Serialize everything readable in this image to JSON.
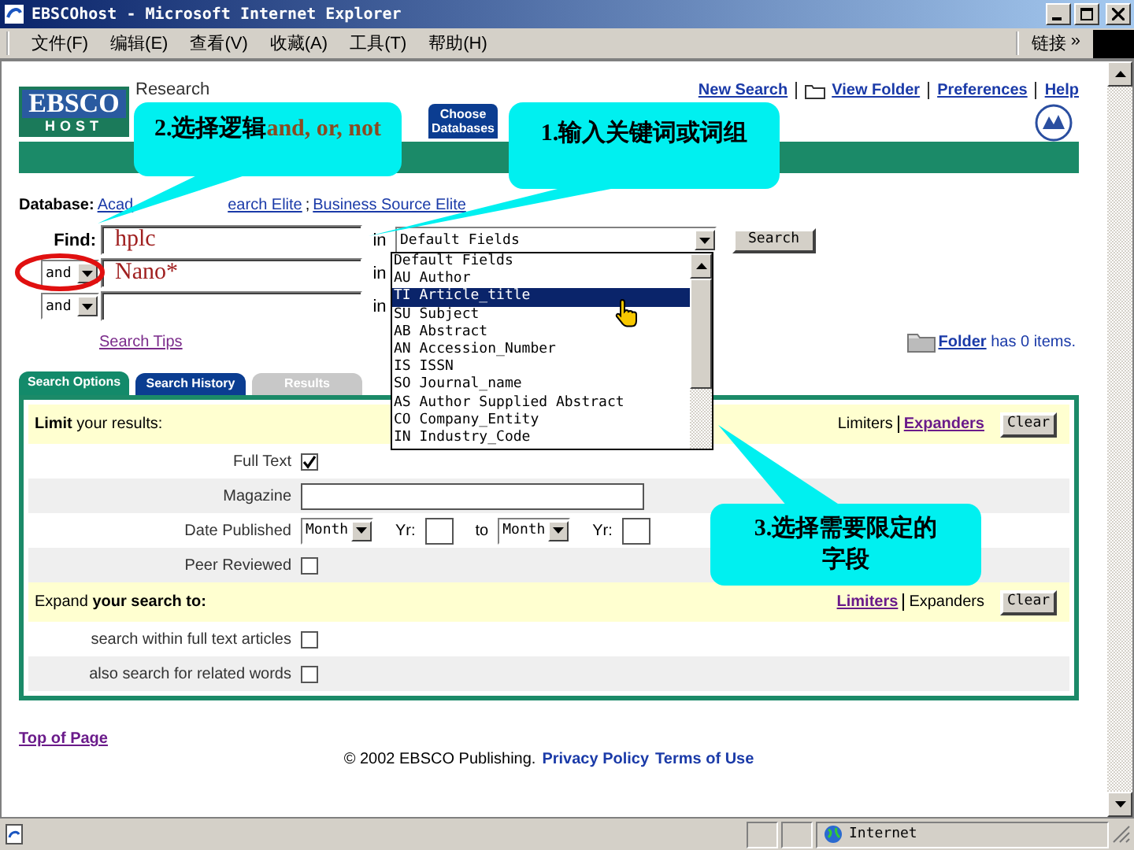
{
  "window": {
    "title": "EBSCOhost - Microsoft Internet Explorer"
  },
  "menu": [
    "文件(F)",
    "编辑(E)",
    "查看(V)",
    "收藏(A)",
    "工具(T)",
    "帮助(H)"
  ],
  "links_bar": {
    "label": "链接",
    "more": "»"
  },
  "header": {
    "logo_top": "EBSCO",
    "logo_bottom": "HOST",
    "product": "Research",
    "db_tab": "Choose Databases",
    "nav": [
      {
        "text": "New Search",
        "icon": false
      },
      {
        "text": "View Folder",
        "icon": true
      },
      {
        "text": "Preferences",
        "icon": false
      },
      {
        "text": "Help",
        "icon": false
      }
    ]
  },
  "database": {
    "label": "Database:",
    "items": [
      {
        "text": "Acad",
        "kind": "link"
      },
      {
        "text": "earch Elite",
        "kind": "link"
      },
      {
        "text": ";",
        "kind": "text"
      },
      {
        "text": "Business Source Elite",
        "kind": "link"
      }
    ]
  },
  "find": {
    "label": "Find:",
    "rows": [
      {
        "operator": "",
        "value": "hplc",
        "in": "in",
        "field": "Default Fields"
      },
      {
        "operator": "and",
        "value": "Nano*",
        "in": "in",
        "field": ""
      },
      {
        "operator": "and",
        "value": "",
        "in": "in",
        "field": ""
      }
    ],
    "search_button": "Search",
    "tips": "Search Tips"
  },
  "field_list": [
    {
      "text": "Default Fields",
      "selected": false
    },
    {
      "text": "AU Author",
      "selected": false
    },
    {
      "text": "TI Article_title",
      "selected": true
    },
    {
      "text": "SU Subject",
      "selected": false
    },
    {
      "text": "AB Abstract",
      "selected": false
    },
    {
      "text": "AN Accession_Number",
      "selected": false
    },
    {
      "text": "IS ISSN",
      "selected": false
    },
    {
      "text": "SO Journal_name",
      "selected": false
    },
    {
      "text": "AS Author Supplied Abstract",
      "selected": false
    },
    {
      "text": "CO Company_Entity",
      "selected": false
    },
    {
      "text": "IN Industry_Code",
      "selected": false
    }
  ],
  "folder": {
    "link": "Folder",
    "text": "has 0 items."
  },
  "tabs": [
    {
      "label": "Search Options",
      "selected": true,
      "color": "#138a6a"
    },
    {
      "label": "Search History",
      "selected": false,
      "color": "#0b3d91"
    },
    {
      "label": "Results",
      "selected": false,
      "color": "#c8c8c8"
    }
  ],
  "sections": [
    {
      "title": "**Limit** your results:",
      "links": [
        {
          "text": "Limiters",
          "kind": "text"
        },
        {
          "text": "Expanders",
          "kind": "link"
        }
      ],
      "button": "Clear",
      "rows": [
        {
          "kind": "checkbox",
          "label": "Full Text",
          "checked": true
        },
        {
          "kind": "input",
          "label": "Magazine"
        },
        {
          "kind": "date",
          "label": "Date Published",
          "month": "Month",
          "yr": "Yr:",
          "to": "to",
          "month2": "Month",
          "yr2": "Yr:"
        },
        {
          "kind": "checkbox",
          "label": "Peer Reviewed",
          "checked": false
        }
      ]
    },
    {
      "title": "Expand **your search to:**",
      "links": [
        {
          "text": "Limiters",
          "kind": "link"
        },
        {
          "text": "Expanders",
          "kind": "text"
        }
      ],
      "button": "Clear",
      "rows": [
        {
          "kind": "checkbox",
          "label": "search within full text articles",
          "checked": false
        },
        {
          "kind": "checkbox",
          "label": "also search for related words",
          "checked": false
        }
      ]
    }
  ],
  "top_link": "Top of Page",
  "footer": {
    "text": "© 2002 EBSCO Publishing.",
    "links": [
      "Privacy Policy",
      "Terms of Use"
    ]
  },
  "callouts": [
    {
      "text": "2.选择逻辑",
      "accent": "and, or, not"
    },
    {
      "text": "1.输入关键词或词组"
    },
    {
      "text": "3.选择需要限定的字段"
    }
  ],
  "status_bar": {
    "zone": "Internet"
  }
}
